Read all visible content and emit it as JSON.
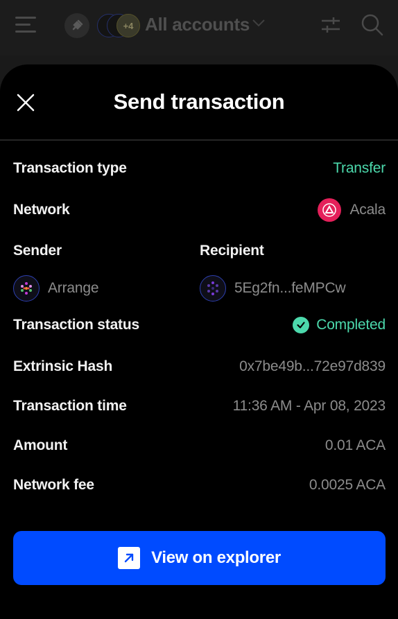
{
  "header": {
    "account_selector_label": "All accounts",
    "extra_accounts_badge": "+4"
  },
  "modal": {
    "title": "Send transaction",
    "rows": {
      "transaction_type": {
        "label": "Transaction type",
        "value": "Transfer"
      },
      "network": {
        "label": "Network",
        "value": "Acala"
      },
      "sender": {
        "label": "Sender",
        "value": "Arrange"
      },
      "recipient": {
        "label": "Recipient",
        "value": "5Eg2fn...feMPCw"
      },
      "transaction_status": {
        "label": "Transaction status",
        "value": "Completed"
      },
      "extrinsic_hash": {
        "label": "Extrinsic Hash",
        "value": "0x7be49b...72e97d839"
      },
      "transaction_time": {
        "label": "Transaction time",
        "value": "11:36 AM - Apr 08, 2023"
      },
      "amount": {
        "label": "Amount",
        "value": "0.01 ACA"
      },
      "network_fee": {
        "label": "Network fee",
        "value": "0.0025 ACA"
      }
    },
    "explorer_button_label": "View on explorer"
  },
  "colors": {
    "accent_blue": "#004bff",
    "success_green": "#4cd9ac",
    "network_logo": "#e4205a"
  },
  "icons": [
    "menu-icon",
    "plug-icon",
    "chevron-down-icon",
    "filter-icon",
    "search-icon",
    "close-icon",
    "acala-logo-icon",
    "check-circle-icon",
    "external-link-icon"
  ]
}
